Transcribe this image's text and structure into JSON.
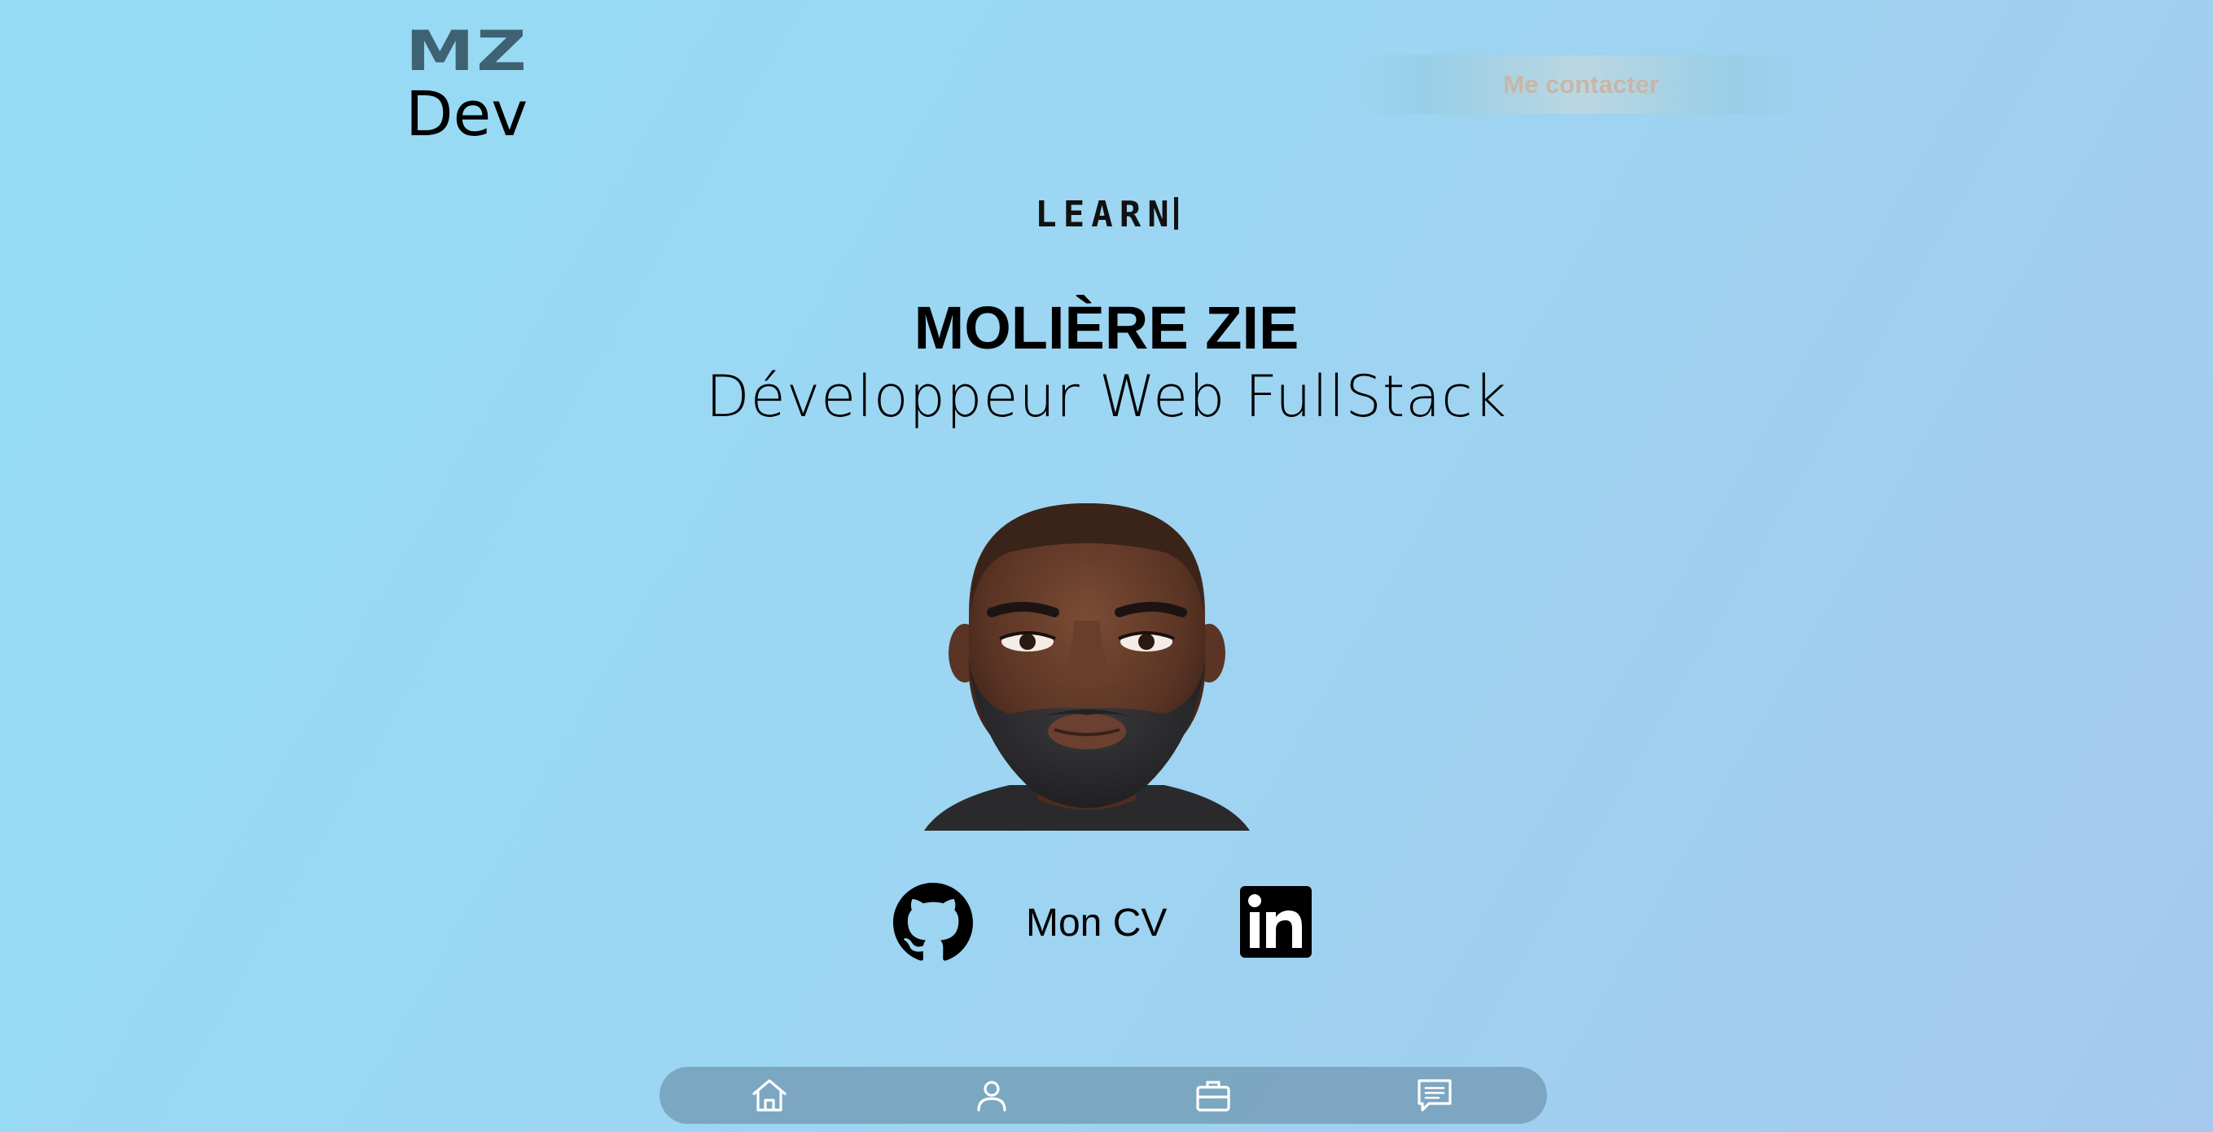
{
  "logo": {
    "line1": "MZ",
    "line2": "Dev"
  },
  "header": {
    "contact_label": "Me contacter"
  },
  "hero": {
    "typing_word": "LEARN",
    "name": "MOLIÈRE ZIE",
    "role": "Développeur Web FullStack"
  },
  "socials": {
    "github_icon": "github-icon",
    "cv_label": "Mon CV",
    "linkedin_icon": "linkedin-icon"
  },
  "nav": {
    "items": [
      {
        "icon": "home-icon"
      },
      {
        "icon": "user-icon"
      },
      {
        "icon": "briefcase-icon"
      },
      {
        "icon": "message-icon"
      }
    ]
  },
  "colors": {
    "background_start": "#95dcf6",
    "background_end": "#a5caee",
    "logo_mz": "#3f6273",
    "nav_bar": "#6e96af",
    "contact_text": "#c9b6a6"
  }
}
